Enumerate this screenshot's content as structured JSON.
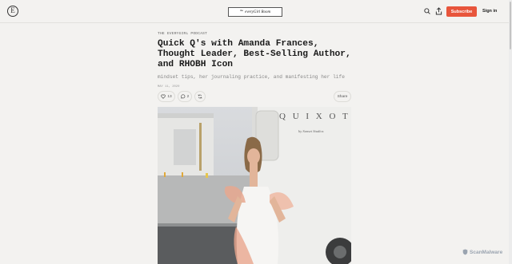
{
  "header": {
    "logo_letter": "E",
    "brand_small": "the",
    "brand_name": "everyGirl Room",
    "subscribe_label": "Subscribe",
    "signin_label": "Sign in"
  },
  "article": {
    "section": "THE EVERYGIRL PODCAST",
    "title": "Quick Q's with Amanda Frances, Thought Leader, Best-Selling Author, and RHOBH Icon",
    "subtitle": "mindset tips, her journaling practice, and manifesting her life",
    "date": "MAY 11, 2020"
  },
  "actions": {
    "likes": "13",
    "comments": "2",
    "share_label": "Share"
  },
  "photo": {
    "sign_text": "Q U I X O T",
    "sign_subtext": "by Sunset Studios"
  },
  "watermark": "ScanMalware",
  "icons": [
    "logo-icon",
    "search-icon",
    "share-icon",
    "heart-icon",
    "comment-icon",
    "restack-icon"
  ],
  "colors": {
    "accent": "#e8553c",
    "background": "#f3f2f0"
  }
}
